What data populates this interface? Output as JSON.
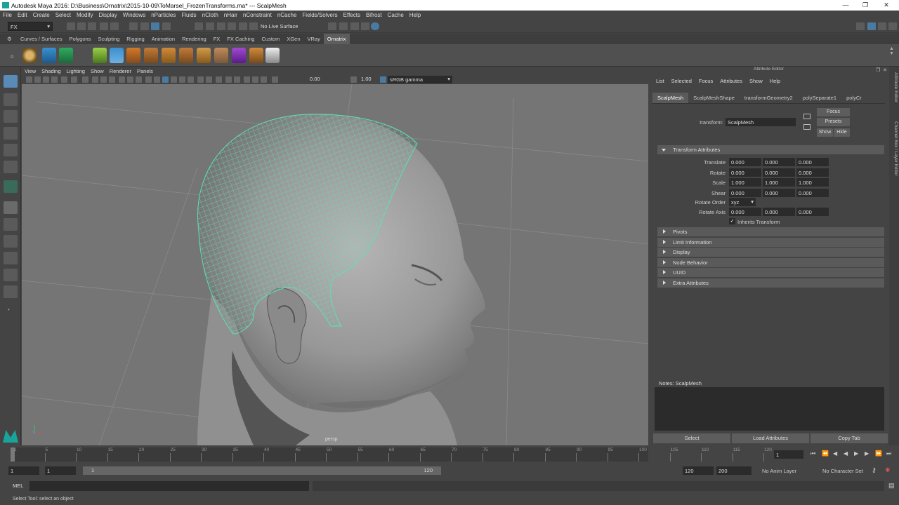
{
  "window": {
    "title": "Autodesk Maya 2016: D:\\Business\\Ornatrix\\2015-10-09\\ToMarsel_FrozenTransforms.ma*   ---   ScalpMesh",
    "controls": [
      "—",
      "❐",
      "✕"
    ]
  },
  "menubar": [
    "File",
    "Edit",
    "Create",
    "Select",
    "Modify",
    "Display",
    "Windows",
    "nParticles",
    "Fluids",
    "nCloth",
    "nHair",
    "nConstraint",
    "nCache",
    "Fields/Solvers",
    "Effects",
    "Bifrost",
    "Cache",
    "Help"
  ],
  "statusline": {
    "menuset": "FX",
    "live_surface": "No Live Surface"
  },
  "shelf_tabs": [
    "Curves / Surfaces",
    "Polygons",
    "Sculpting",
    "Rigging",
    "Animation",
    "Rendering",
    "FX",
    "FX Caching",
    "Custom",
    "XGen",
    "VRay",
    "Ornatrix"
  ],
  "shelf_active": "Ornatrix",
  "viewport": {
    "menu": [
      "View",
      "Shading",
      "Lighting",
      "Show",
      "Renderer",
      "Panels"
    ],
    "exposure": "0.00",
    "gamma": "1.00",
    "color_space": "sRGB gamma",
    "camera_label": "persp"
  },
  "attribute_editor": {
    "title": "Attribute Editor",
    "menu": [
      "List",
      "Selected",
      "Focus",
      "Attributes",
      "Show",
      "Help"
    ],
    "tabs": [
      "ScalpMesh",
      "ScalpMeshShape",
      "transformGeometry2",
      "polySeparate1",
      "polyCr"
    ],
    "active_tab": "ScalpMesh",
    "transform_label": "transform:",
    "transform_value": "ScalpMesh",
    "buttons": {
      "focus": "Focus",
      "presets": "Presets",
      "show": "Show",
      "hide": "Hide"
    },
    "transform_section": "Transform Attributes",
    "rows": [
      {
        "label": "Translate",
        "values": [
          "0.000",
          "0.000",
          "0.000"
        ]
      },
      {
        "label": "Rotate",
        "values": [
          "0.000",
          "0.000",
          "0.000"
        ]
      },
      {
        "label": "Scale",
        "values": [
          "1.000",
          "1.000",
          "1.000"
        ]
      },
      {
        "label": "Shear",
        "values": [
          "0.000",
          "0.000",
          "0.000"
        ]
      }
    ],
    "rotate_order_label": "Rotate Order",
    "rotate_order_value": "xyz",
    "rotate_axis_label": "Rotate Axis",
    "rotate_axis_values": [
      "0.000",
      "0.000",
      "0.000"
    ],
    "inherits_transform": "Inherits Transform",
    "collapsed_sections": [
      "Pivots",
      "Limit Information",
      "Display",
      "Node Behavior",
      "UUID",
      "Extra Attributes"
    ],
    "notes_label": "Notes:  ScalpMesh",
    "bottom_buttons": [
      "Select",
      "Load Attributes",
      "Copy Tab"
    ]
  },
  "side_tabs": [
    "Attribute Editor",
    "Channel Box / Layer Editor"
  ],
  "timeline": {
    "ticks": [
      "1",
      "5",
      "10",
      "15",
      "20",
      "25",
      "30",
      "35",
      "40",
      "45",
      "50",
      "55",
      "60",
      "65",
      "70",
      "75",
      "80",
      "85",
      "90",
      "95",
      "100",
      "105",
      "110",
      "115",
      "120"
    ],
    "current_frame": "1",
    "range_start": "1",
    "range_inner_start": "1",
    "range_inner_start_label": "1",
    "range_inner_end_label": "120",
    "range_end": "120",
    "anim_end": "200",
    "anim_layer": "No Anim Layer",
    "character_set": "No Character Set"
  },
  "command_line": {
    "lang": "MEL"
  },
  "help_line": "Select Tool: select an object"
}
